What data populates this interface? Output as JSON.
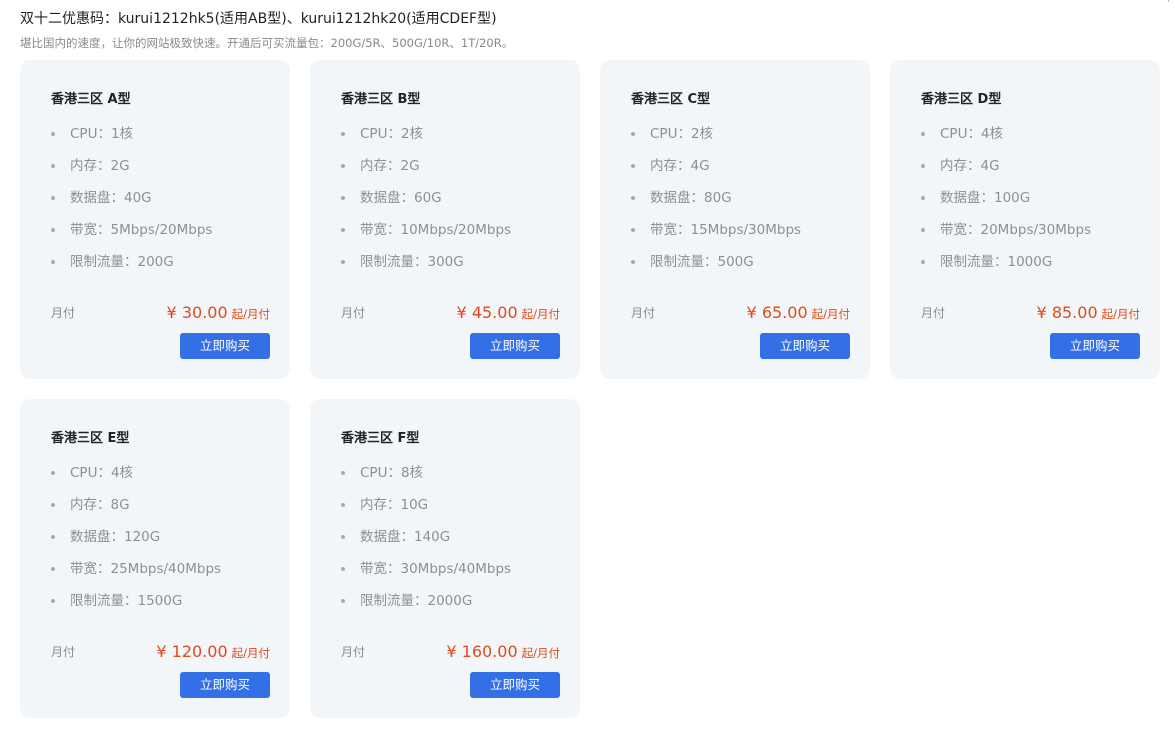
{
  "promo": {
    "title": "双十二优惠码：kurui1212hk5(适用AB型)、kurui1212hk20(适用CDEF型)",
    "subtitle": "堪比国内的速度，让你的网站极致快速。开通后可买流量包：200G/5R、500G/10R、1T/20R。"
  },
  "colors": {
    "card_bg": "#f3f6f9",
    "price": "#e04a1a",
    "button": "#3370e6"
  },
  "cards": [
    {
      "name": "香港三区 A型",
      "specs": [
        "CPU：1核",
        "内存：2G",
        "数据盘：40G",
        "带宽：5Mbps/20Mbps",
        "限制流量：200G"
      ],
      "cycle": "月付",
      "price": "¥ 30.00",
      "unit": "起/月付",
      "button": "立即购买"
    },
    {
      "name": "香港三区 B型",
      "specs": [
        "CPU：2核",
        "内存：2G",
        "数据盘：60G",
        "带宽：10Mbps/20Mbps",
        "限制流量：300G"
      ],
      "cycle": "月付",
      "price": "¥ 45.00",
      "unit": "起/月付",
      "button": "立即购买"
    },
    {
      "name": "香港三区 C型",
      "specs": [
        "CPU：2核",
        "内存：4G",
        "数据盘：80G",
        "带宽：15Mbps/30Mbps",
        "限制流量：500G"
      ],
      "cycle": "月付",
      "price": "¥ 65.00",
      "unit": "起/月付",
      "button": "立即购买"
    },
    {
      "name": "香港三区 D型",
      "specs": [
        "CPU：4核",
        "内存：4G",
        "数据盘：100G",
        "带宽：20Mbps/30Mbps",
        "限制流量：1000G"
      ],
      "cycle": "月付",
      "price": "¥ 85.00",
      "unit": "起/月付",
      "button": "立即购买"
    },
    {
      "name": "香港三区 E型",
      "specs": [
        "CPU：4核",
        "内存：8G",
        "数据盘：120G",
        "带宽：25Mbps/40Mbps",
        "限制流量：1500G"
      ],
      "cycle": "月付",
      "price": "¥ 120.00",
      "unit": "起/月付",
      "button": "立即购买"
    },
    {
      "name": "香港三区 F型",
      "specs": [
        "CPU：8核",
        "内存：10G",
        "数据盘：140G",
        "带宽：30Mbps/40Mbps",
        "限制流量：2000G"
      ],
      "cycle": "月付",
      "price": "¥ 160.00",
      "unit": "起/月付",
      "button": "立即购买"
    }
  ]
}
